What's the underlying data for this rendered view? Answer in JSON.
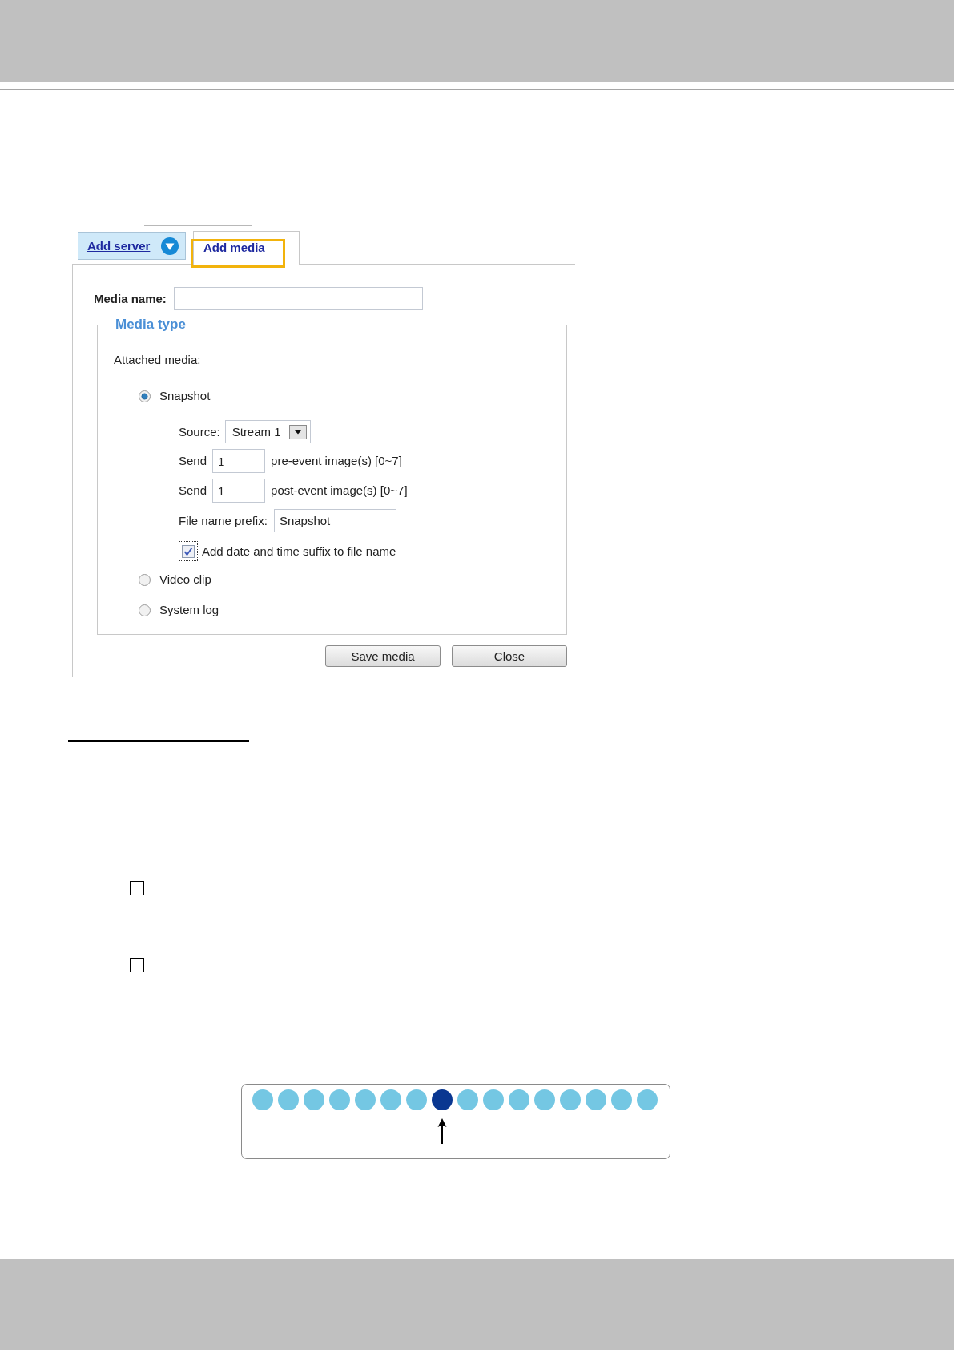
{
  "dialog": {
    "tabs": [
      {
        "label": "Add server",
        "selected": false,
        "dropdown": true,
        "highlighted": false
      },
      {
        "label": "Add media",
        "selected": true,
        "dropdown": false,
        "highlighted": true
      }
    ],
    "media_name": {
      "label": "Media name:"
    },
    "media_type": {
      "legend": "Media type",
      "attached_label": "Attached media:",
      "options": [
        {
          "label": "Snapshot",
          "selected": true,
          "settings": {
            "source": {
              "label": "Source:",
              "value": "Stream 1"
            },
            "pre_event": {
              "label": "Send",
              "value": "1",
              "suffix": "pre-event image(s) [0~7]"
            },
            "post_event": {
              "label": "Send",
              "value": "1",
              "suffix": "post-event image(s) [0~7]"
            },
            "prefix": {
              "label": "File name prefix:",
              "value": "Snapshot_"
            },
            "date_suffix": {
              "label": "Add date and time suffix to file name",
              "checked": true,
              "focused": true
            }
          }
        },
        {
          "label": "Video clip",
          "selected": false
        },
        {
          "label": "System log",
          "selected": false
        }
      ]
    },
    "buttons": [
      "Save media",
      "Close"
    ]
  },
  "checklist": [
    {
      "checked": false
    },
    {
      "checked": false
    }
  ],
  "dot_diagram": {
    "dots": [
      {
        "selected": false
      },
      {
        "selected": false
      },
      {
        "selected": false
      },
      {
        "selected": false
      },
      {
        "selected": false
      },
      {
        "selected": false
      },
      {
        "selected": false
      },
      {
        "selected": true
      },
      {
        "selected": false
      },
      {
        "selected": false
      },
      {
        "selected": false
      },
      {
        "selected": false
      },
      {
        "selected": false
      },
      {
        "selected": false
      },
      {
        "selected": false
      },
      {
        "selected": false
      }
    ]
  }
}
